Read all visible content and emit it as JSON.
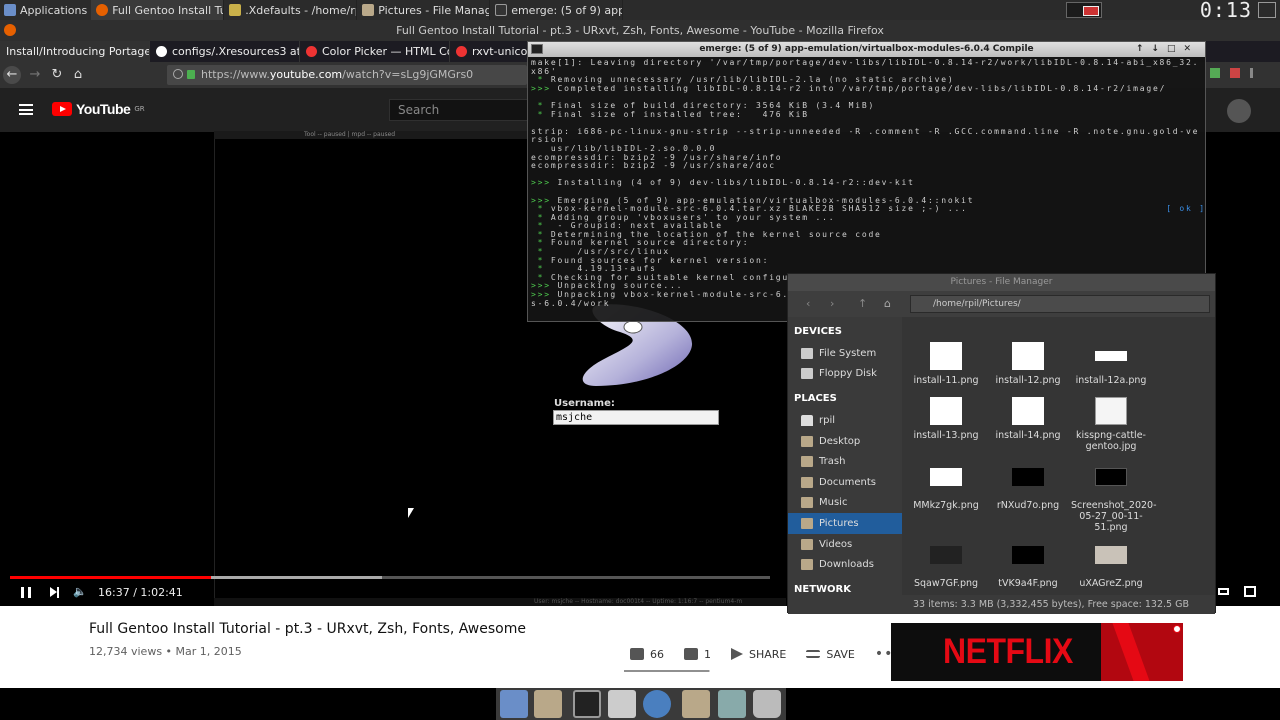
{
  "panel": {
    "app_menu_label": "Applications",
    "tasks": [
      {
        "label": "Full Gentoo Install Tutor..."
      },
      {
        "label": ".Xdefaults - /home/rpil -..."
      },
      {
        "label": "Pictures - File Manager"
      },
      {
        "label": "emerge: (5 of 9) app-e..."
      }
    ],
    "clock": "0:13"
  },
  "firefox": {
    "window_title": "Full Gentoo Install Tutorial - pt.3 - URxvt, Zsh, Fonts, Awesome - YouTube - Mozilla Firefox",
    "tabs": [
      {
        "label": "Install/Introducing Portage -"
      },
      {
        "label": "configs/.Xresources3 at n"
      },
      {
        "label": "Color Picker — HTML Col"
      },
      {
        "label": "rxvt-unicode"
      }
    ],
    "url_scheme": "https://www.",
    "url_host": "youtube.com",
    "url_path": "/watch?v=sLg9jGMGrs0"
  },
  "youtube": {
    "logo_text": "YouTube",
    "region": "GR",
    "search_placeholder": "Search",
    "player": {
      "time": "16:37 / 1:02:41",
      "progress": 0.265,
      "buffered_end": 0.49,
      "inner_top_bar": "Tool -- paused | mpd -- paused",
      "inner_bottom_bar": "User: msjche -- Hostname: doc001t4 -- Uptime: 1:16:7 -- pentium4-m",
      "login_label": "Username:",
      "login_value": "msjche"
    },
    "video_title": "Full Gentoo Install Tutorial - pt.3 - URxvt, Zsh, Fonts, Awesome",
    "views_date": "12,734 views • Mar 1, 2015",
    "likes": "66",
    "dislikes": "1",
    "like_ratio": 0.985,
    "share_label": "SHARE",
    "save_label": "SAVE",
    "ad_brand": "NETFLIX"
  },
  "terminal": {
    "title": "emerge: (5 of 9) app-emulation/virtualbox-modules-6.0.4 Compile",
    "lines": [
      {
        "t": "make[1]: Leaving directory '/var/tmp/portage/dev-libs/libIDL-0.8.14-r2/work/libIDL-0.8.14-abi_x86_32.",
        "c": ""
      },
      {
        "t": "x86'",
        "c": ""
      },
      {
        "t": " * Removing unnecessary /usr/lib/libIDL-2.la (no static archive)",
        "c": ""
      },
      {
        "t": ">>> Completed installing libIDL-0.8.14-r2 into /var/tmp/portage/dev-libs/libIDL-0.8.14-r2/image/",
        "c": ""
      },
      {
        "t": "",
        "c": ""
      },
      {
        "t": " * Final size of build directory: 3564 KiB (3.4 MiB)",
        "c": ""
      },
      {
        "t": " * Final size of installed tree:   476 KiB",
        "c": ""
      },
      {
        "t": "",
        "c": ""
      },
      {
        "t": "strip: i686-pc-linux-gnu-strip --strip-unneeded -R .comment -R .GCC.command.line -R .note.gnu.gold-ve",
        "c": ""
      },
      {
        "t": "rsion",
        "c": ""
      },
      {
        "t": "   usr/lib/libIDL-2.so.0.0.0",
        "c": ""
      },
      {
        "t": "ecompressdir: bzip2 -9 /usr/share/info",
        "c": ""
      },
      {
        "t": "ecompressdir: bzip2 -9 /usr/share/doc",
        "c": ""
      },
      {
        "t": "",
        "c": ""
      },
      {
        "t": ">>> Installing (4 of 9) dev-libs/libIDL-0.8.14-r2::dev-kit",
        "c": ""
      },
      {
        "t": "",
        "c": ""
      },
      {
        "t": ">>> Emerging (5 of 9) app-emulation/virtualbox-modules-6.0.4::nokit",
        "c": ""
      },
      {
        "t": " * vbox-kernel-module-src-6.0.4.tar.xz BLAKE2B SHA512 size ;-) ...                              [ ok ]",
        "c": ""
      },
      {
        "t": " * Adding group 'vboxusers' to your system ...",
        "c": ""
      },
      {
        "t": " *  - Groupid: next available",
        "c": ""
      },
      {
        "t": " * Determining the location of the kernel source code",
        "c": ""
      },
      {
        "t": " * Found kernel source directory:",
        "c": ""
      },
      {
        "t": " *     /usr/src/linux",
        "c": ""
      },
      {
        "t": " * Found sources for kernel version:",
        "c": ""
      },
      {
        "t": " *     4.19.13-aufs",
        "c": ""
      },
      {
        "t": " * Checking for suitable kernel configuration options...                                      [ ok ]",
        "c": ""
      },
      {
        "t": ">>> Unpacking source...",
        "c": ""
      },
      {
        "t": ">>> Unpacking vbox-kernel-module-src-6.0.4.tar.xz to /var/tmp/portage/app-emulation/virtualbox-module",
        "c": ""
      },
      {
        "t": "s-6.0.4/work",
        "c": ""
      }
    ]
  },
  "file_manager": {
    "title": "Pictures - File Manager",
    "path": "/home/rpil/Pictures/",
    "devices_header": "DEVICES",
    "devices": [
      "File System",
      "Floppy Disk"
    ],
    "places_header": "PLACES",
    "places": [
      "rpil",
      "Desktop",
      "Trash",
      "Documents",
      "Music",
      "Pictures",
      "Videos",
      "Downloads"
    ],
    "network_header": "NETWORK",
    "files": [
      {
        "name": "install-11.png"
      },
      {
        "name": "install-12.png"
      },
      {
        "name": "install-12a.png"
      },
      {
        "name": "install-13.png"
      },
      {
        "name": "install-14.png"
      },
      {
        "name": "kisspng-cattle-gentoo.jpg"
      },
      {
        "name": "MMkz7gk.png"
      },
      {
        "name": "rNXud7o.png"
      },
      {
        "name": "Screenshot_2020-05-27_00-11-51.png"
      },
      {
        "name": "Sqaw7GF.png"
      },
      {
        "name": "tVK9a4F.png"
      },
      {
        "name": "uXAGreZ.png"
      }
    ],
    "status": "33 items: 3.3 MB (3,332,455 bytes), Free space: 132.5 GB"
  }
}
